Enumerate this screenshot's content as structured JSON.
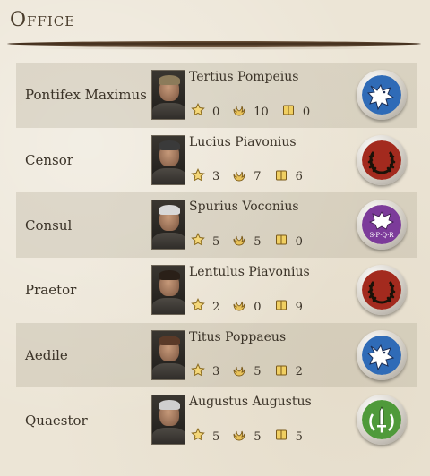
{
  "header": {
    "title": "Office"
  },
  "colors": {
    "blue_badge": "#2f6bb7",
    "red_badge": "#a32a1e",
    "purple_badge": "#7c3b9a",
    "green_badge": "#4f9a3a",
    "stat_icon": "#c9a23a"
  },
  "offices": [
    {
      "office": "Pontifex Maximus",
      "name": "Tertius Pompeius",
      "stats": {
        "star": "0",
        "laurel": "10",
        "scroll": "0"
      },
      "badge": "wolf-icon",
      "badge_color": "#2f6bb7",
      "hair": "#8c7b5a"
    },
    {
      "office": "Censor",
      "name": "Lucius Piavonius",
      "stats": {
        "star": "3",
        "laurel": "7",
        "scroll": "6"
      },
      "badge": "laurel-wreath-icon",
      "badge_color": "#a32a1e",
      "hair": "#3a3a3a"
    },
    {
      "office": "Consul",
      "name": "Spurius Voconius",
      "stats": {
        "star": "5",
        "laurel": "5",
        "scroll": "0"
      },
      "badge": "spqr-eagle-icon",
      "badge_color": "#7c3b9a",
      "badge_text": "S·P·Q·R",
      "hair": "#d8d8d8"
    },
    {
      "office": "Praetor",
      "name": "Lentulus Piavonius",
      "stats": {
        "star": "2",
        "laurel": "0",
        "scroll": "9"
      },
      "badge": "laurel-wreath-icon",
      "badge_color": "#a32a1e",
      "hair": "#2a2018"
    },
    {
      "office": "Aedile",
      "name": "Titus Poppaeus",
      "stats": {
        "star": "3",
        "laurel": "5",
        "scroll": "2"
      },
      "badge": "wolf-icon",
      "badge_color": "#2f6bb7",
      "hair": "#5a3a28"
    },
    {
      "office": "Quaestor",
      "name": "Augustus Augustus",
      "stats": {
        "star": "5",
        "laurel": "5",
        "scroll": "5"
      },
      "badge": "sword-laurel-icon",
      "badge_color": "#4f9a3a",
      "hair": "#cfcfcf"
    }
  ]
}
